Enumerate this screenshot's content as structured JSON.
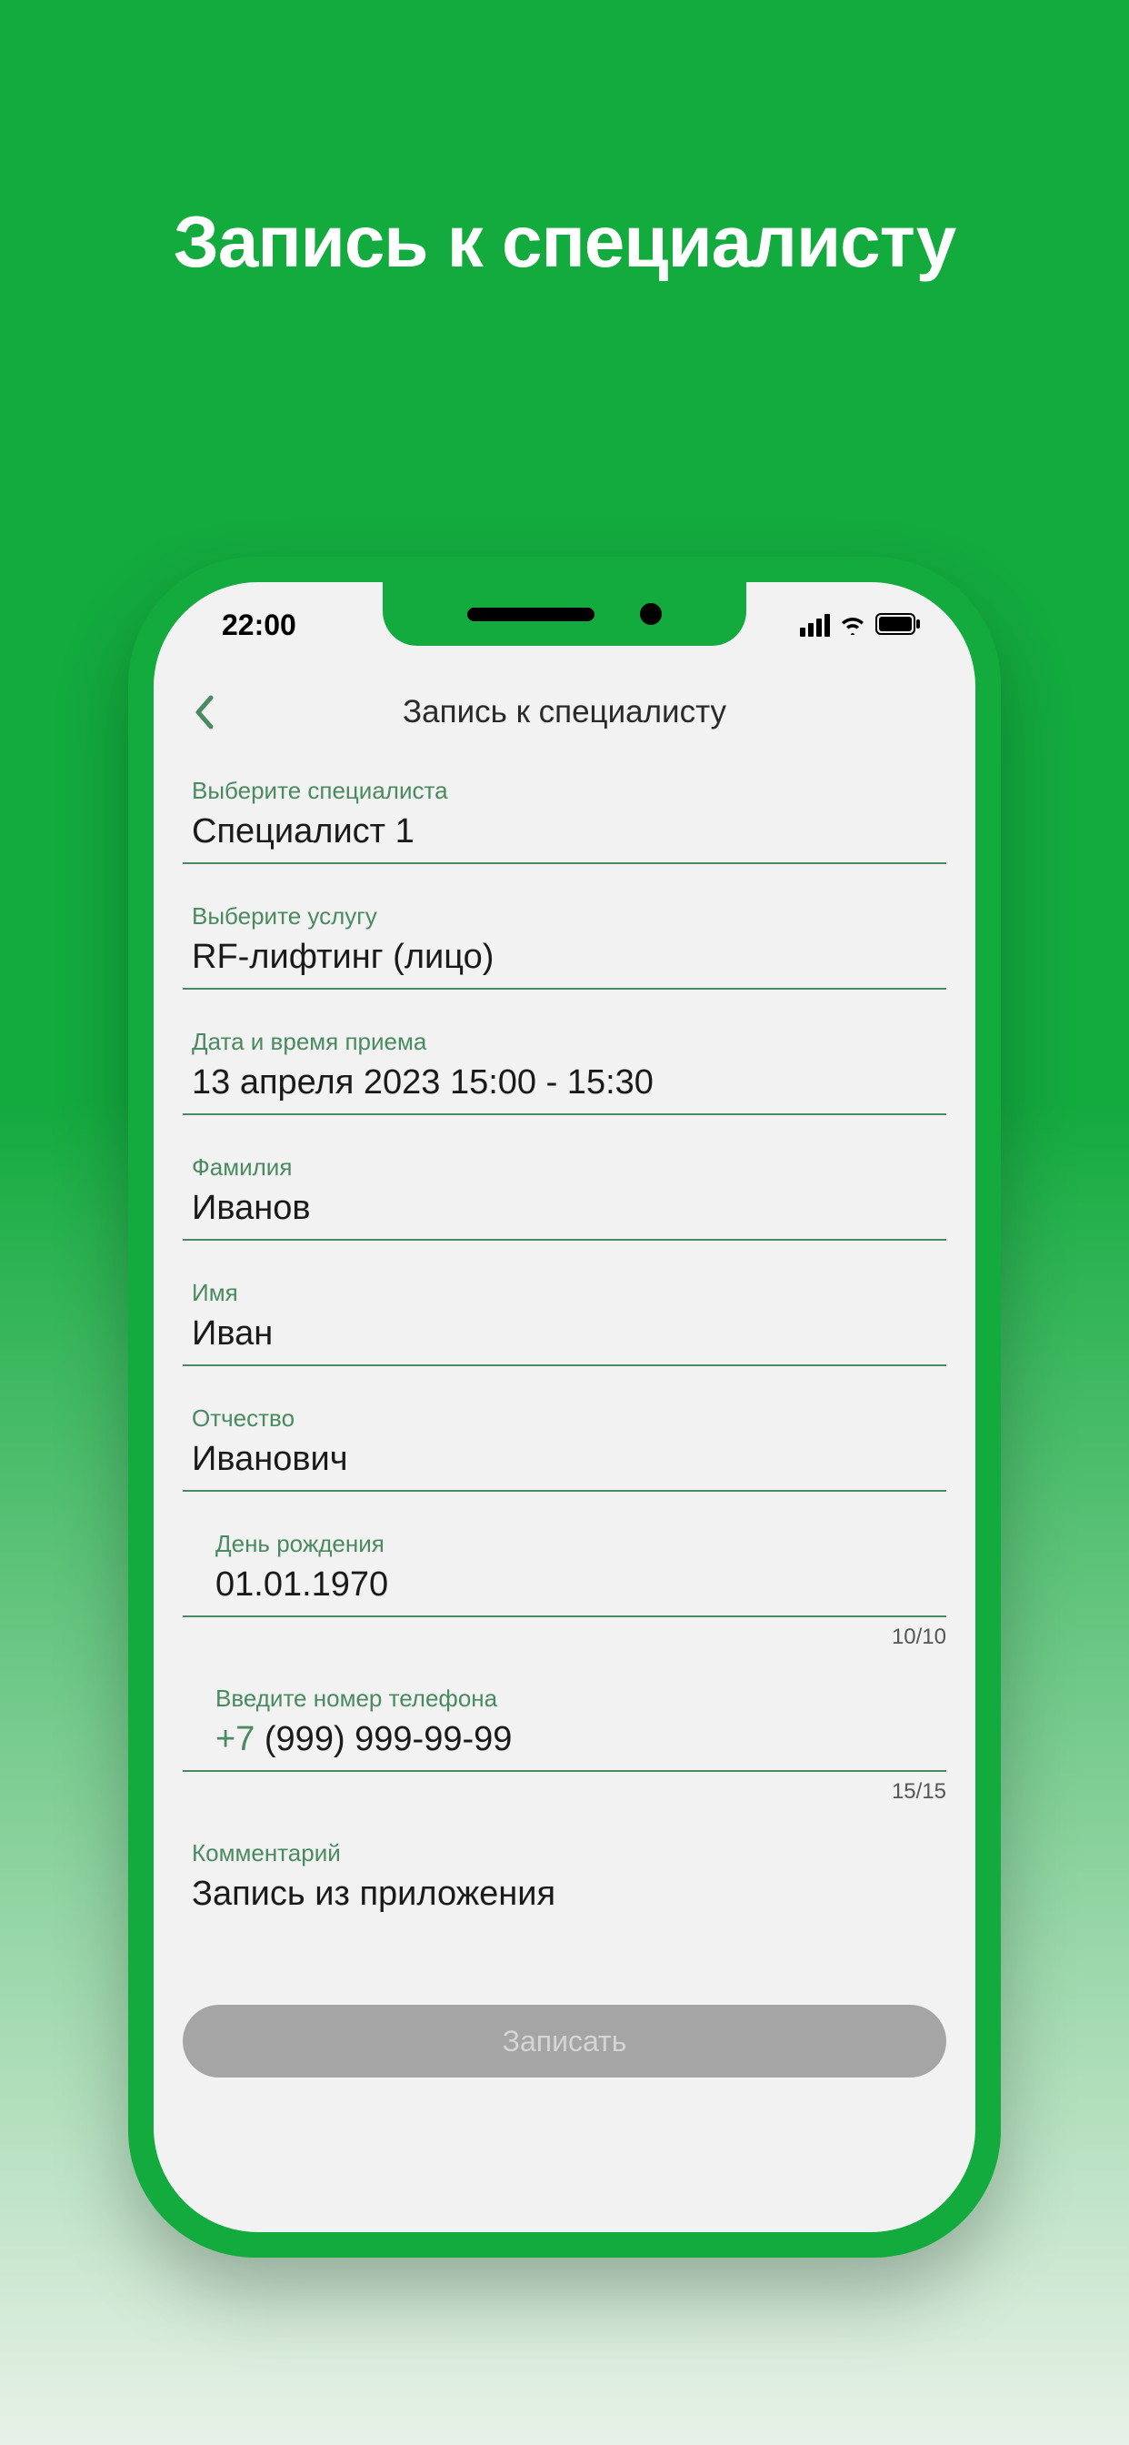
{
  "hero": {
    "title": "Запись к специалисту"
  },
  "status": {
    "time": "22:00"
  },
  "nav": {
    "title": "Запись к специалисту"
  },
  "fields": {
    "specialist": {
      "label": "Выберите специалиста",
      "value": "Специалист 1"
    },
    "service": {
      "label": "Выберите услугу",
      "value": "RF-лифтинг  (лицо)"
    },
    "datetime": {
      "label": "Дата и время приема",
      "value": "13 апреля 2023   15:00 - 15:30"
    },
    "surname": {
      "label": "Фамилия",
      "value": "Иванов"
    },
    "name": {
      "label": "Имя",
      "value": "Иван"
    },
    "patronymic": {
      "label": "Отчество",
      "value": "Иванович"
    },
    "birthday": {
      "label": "День рождения",
      "value": "01.01.1970",
      "counter": "10/10"
    },
    "phone": {
      "label": "Введите номер телефона",
      "prefix": "+7 ",
      "rest": "(999) 999-99-99",
      "counter": "15/15"
    },
    "comment": {
      "label": "Комментарий",
      "value": "Запись из приложения"
    }
  },
  "submit": {
    "label": "Записать"
  }
}
